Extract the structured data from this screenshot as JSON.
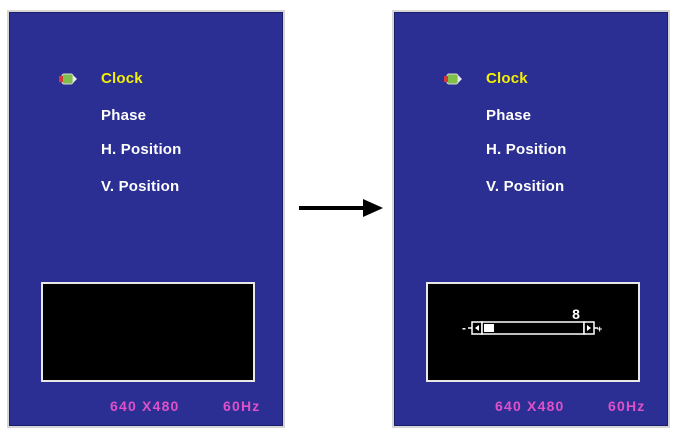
{
  "screens": [
    {
      "menu": [
        "Clock",
        "Phase",
        "H. Position",
        "V. Position"
      ],
      "active_index": 0,
      "resolution": "640 X480",
      "refresh": "60Hz",
      "slider_visible": false
    },
    {
      "menu": [
        "Clock",
        "Phase",
        "H. Position",
        "V. Position"
      ],
      "active_index": 0,
      "resolution": "640 X480",
      "refresh": "60Hz",
      "slider_visible": true,
      "slider": {
        "value": "8",
        "level_fraction": 0.1,
        "minus_label": "-",
        "plus_label": "+"
      }
    }
  ],
  "colors": {
    "panel_bg": "#2b2f93",
    "active_text": "#f4f000",
    "status_text": "#e050c8"
  },
  "icons": [
    "menu-cursor-icon",
    "right-arrow-icon",
    "slider-left-button-icon",
    "slider-right-button-icon"
  ]
}
